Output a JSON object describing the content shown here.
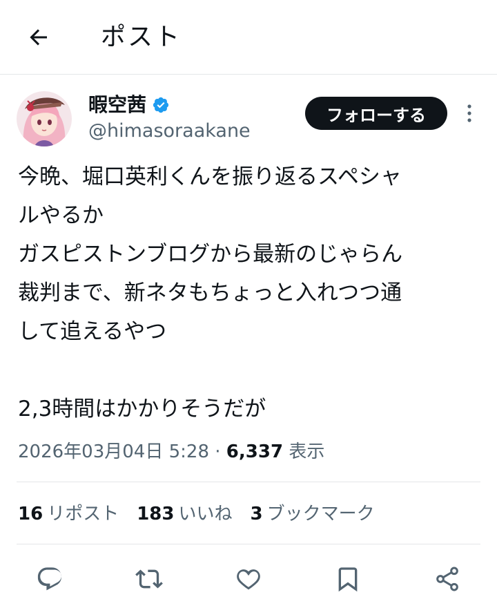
{
  "header": {
    "back_icon": "arrow-left-icon",
    "title": "ポスト"
  },
  "author": {
    "display_name": "暇空茜",
    "verified_icon": "verified-badge-icon",
    "verified_color": "#1d9bf0",
    "handle": "@himasoraakane",
    "follow_label": "フォローする",
    "more_icon": "more-vertical-icon"
  },
  "tweet": {
    "lines": [
      "今晩、堀口英利くんを振り返るスペシャ",
      "ルやるか",
      "ガスピストンブログから最新のじゃらん",
      "裁判まで、新ネタもちょっと入れつつ通",
      "して追えるやつ",
      "",
      "2,3時間はかかりそうだが"
    ]
  },
  "meta": {
    "timestamp": "2026年03月04日 5:28",
    "separator": "·",
    "views": "6,337",
    "views_label": "表示"
  },
  "stats": {
    "reposts": "16",
    "reposts_label": "リポスト",
    "likes": "183",
    "likes_label": "いいね",
    "bookmarks": "3",
    "bookmarks_label": "ブックマーク"
  },
  "actions": [
    "reply-icon",
    "repost-icon",
    "like-icon",
    "bookmark-icon",
    "share-icon"
  ],
  "colors": {
    "text": "#0f1419",
    "secondary": "#536471",
    "divider": "#e4e6e8",
    "follow_bg": "#0f1419"
  }
}
